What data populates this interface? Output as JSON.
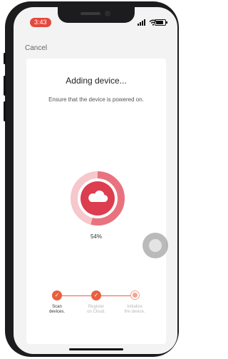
{
  "status_bar": {
    "time": "3:43"
  },
  "nav": {
    "cancel_label": "Cancel"
  },
  "main": {
    "title": "Adding device...",
    "subtitle": "Ensure that the device is powered on.",
    "progress": {
      "value": 0.54,
      "label": "54%"
    }
  },
  "steps": [
    {
      "label_line1": "Scan",
      "label_line2": "devices.",
      "state": "done"
    },
    {
      "label_line1": "Register",
      "label_line2": "on Cloud.",
      "state": "done"
    },
    {
      "label_line1": "Initialize",
      "label_line2": "the device.",
      "state": "pending"
    }
  ],
  "colors": {
    "accent": "#e9603f",
    "ring_inner": "#dc3d4f",
    "ring_progress": "#e8737e",
    "ring_track": "#f6c7cc",
    "time_pill": "#e5483d"
  },
  "icons": {
    "cloud": "cloud-icon",
    "check": "check-icon",
    "wifi": "wifi-icon",
    "battery": "battery-icon",
    "signal": "signal-icon"
  }
}
